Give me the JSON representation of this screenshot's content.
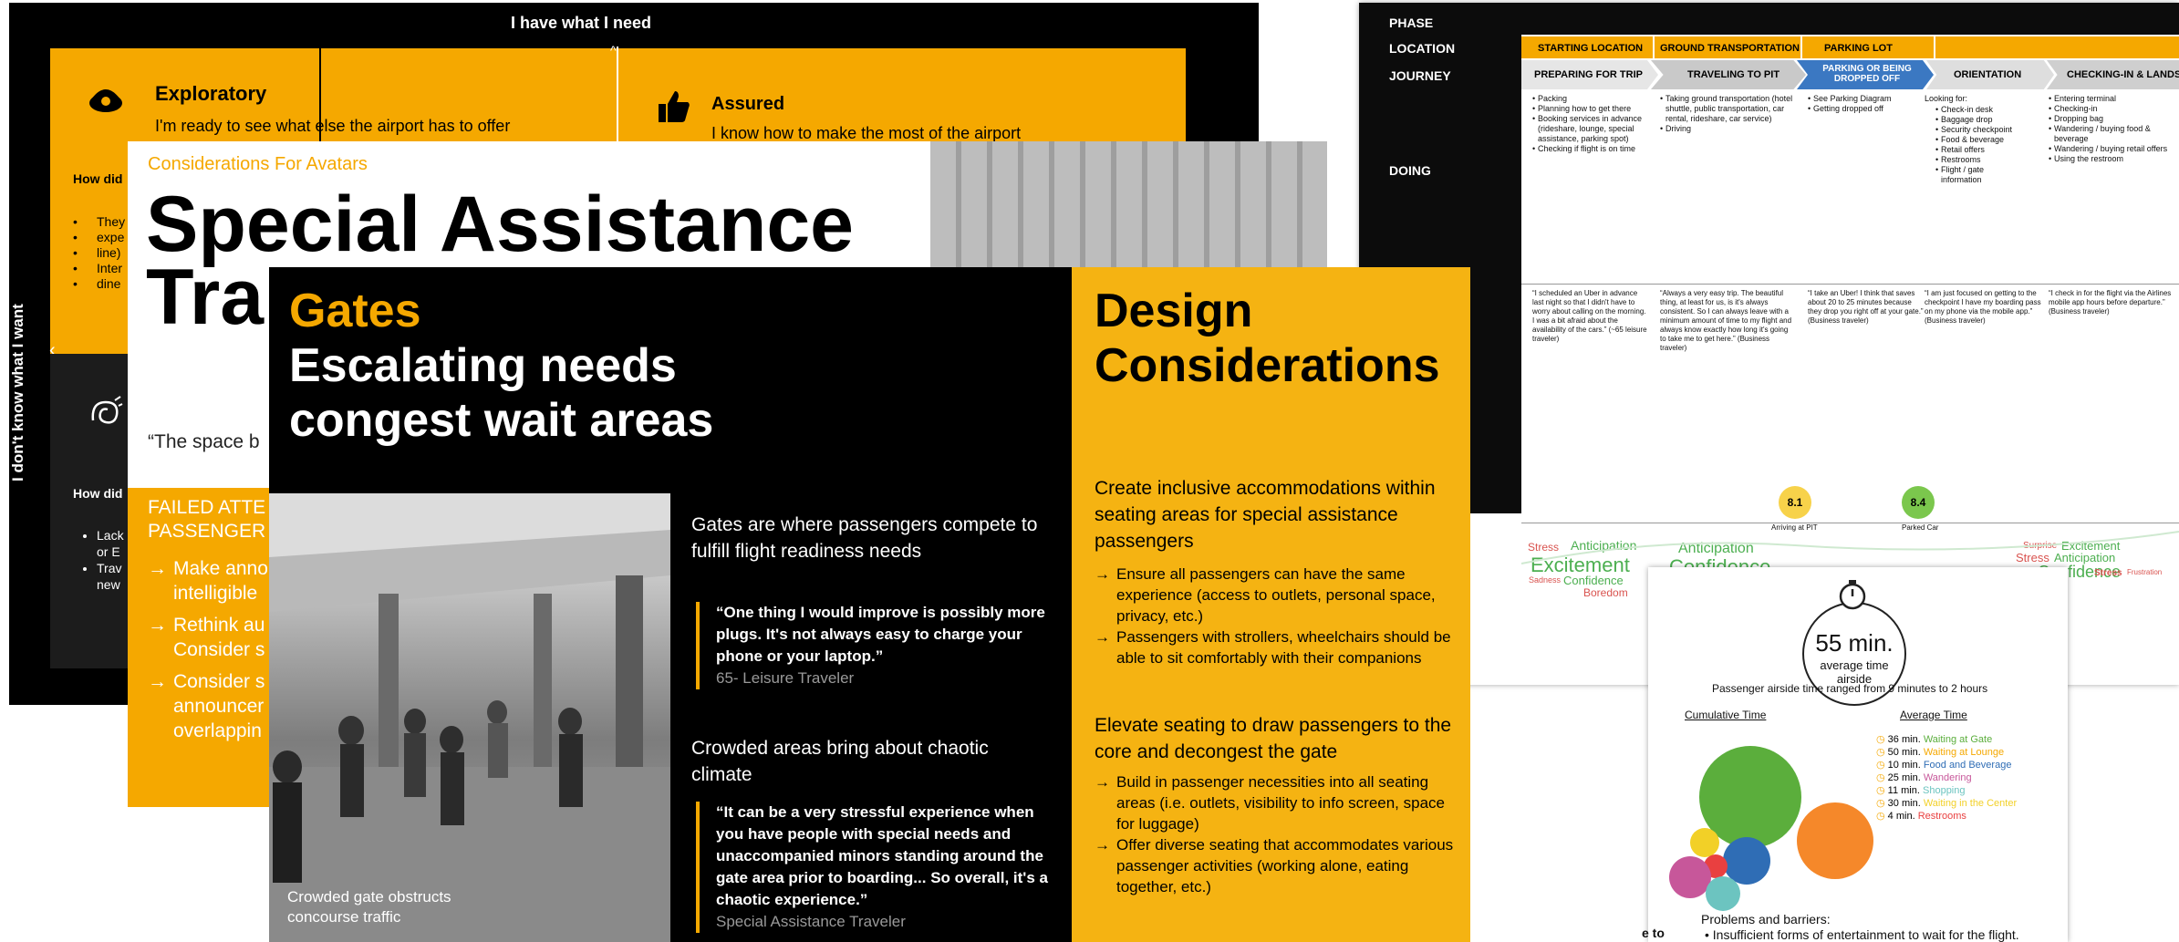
{
  "colors": {
    "accent": "#F5A800",
    "dark": "#000000",
    "dark_card": "#161616",
    "grey_text": "#999999"
  },
  "card1": {
    "top_label": "I have what I need",
    "left_axis": "I don't know what I want",
    "exploratory_title": "Exploratory",
    "exploratory_desc": "I'm ready to see what else the airport has to offer",
    "assured_title": "Assured",
    "assured_desc": "I know how to make the most of the airport",
    "how_did_1": "How did",
    "how_did_2": "How did",
    "bullets_top": [
      "They",
      "expe",
      "line)",
      "Inter",
      "dine"
    ],
    "bullets_bottom": [
      "Lack",
      "or E",
      "Trav",
      "new"
    ],
    "icon_exploratory": "oyster-pearl-icon",
    "icon_assured": "thumbs-up-icon",
    "icon_lower": "swirl-icon"
  },
  "card2": {
    "kicker": "Considerations For Avatars",
    "title_line1": "Special Assistance",
    "title_line2": "Tra",
    "quote_fragment": "“The space b",
    "failed_line1": "FAILED ATTE",
    "failed_line2": "PASSENGER",
    "items": [
      "Make anno",
      "intelligible",
      "Rethink au",
      "Consider s",
      "Consider s",
      "announcer",
      "overlappin"
    ]
  },
  "card3": {
    "title_yellow": "Gates",
    "title_white_1": "Escalating needs",
    "title_white_2": "congest wait areas",
    "photo_caption_1": "Crowded gate obstructs",
    "photo_caption_2": "concourse traffic",
    "section1_heading": "Gates are where passengers compete to fulfill flight readiness needs",
    "quote1": "“One thing I would improve is possibly more plugs. It's not always easy to charge your phone or your laptop.”",
    "quote1_author": "65- Leisure Traveler",
    "section2_heading": "Crowded areas bring about chaotic climate",
    "quote2": "“It can be a very stressful experience when you have people with special needs and unaccompanied minors standing around the gate area prior to boarding... So overall, it's a chaotic experience.”",
    "quote2_author": "Special Assistance Traveler"
  },
  "card4": {
    "title_1": "Design",
    "title_2": "Considerations",
    "heading1": "Create inclusive accommodations within seating areas for special assistance passengers",
    "items1": [
      "Ensure all passengers can have the same experience (access to outlets, personal space, privacy, etc.)",
      "Passengers with strollers, wheelchairs should be able to sit comfortably with their companions"
    ],
    "heading2": "Elevate seating to draw passengers to the core and decongest the gate",
    "items2": [
      "Build in passenger necessities into all seating areas (i.e. outlets, visibility to info screen, space for luggage)",
      "Offer diverse seating that accommodates various passenger activities (working alone, eating together, etc.)"
    ]
  },
  "card5": {
    "row_labels": [
      "PHASE",
      "LOCATION",
      "JOURNEY",
      "DOING"
    ],
    "locations": [
      "STARTING LOCATION",
      "GROUND TRANSPORTATION",
      "PARKING LOT"
    ],
    "journey": [
      "PREPARING FOR TRIP",
      "TRAVELING TO PIT",
      "PARKING OR BEING DROPPED OFF",
      "ORIENTATION",
      "CHECKING-IN & LANDSIDE"
    ],
    "doing": [
      [
        "Packing",
        "Planning how to get there",
        "Booking services in advance (rideshare, lounge, special assistance, parking spot)",
        "Checking if flight is on time"
      ],
      [
        "Taking ground transportation (hotel shuttle, public transportation, car rental, rideshare, car service)",
        "Driving"
      ],
      [
        "See Parking Diagram",
        "Getting dropped off"
      ],
      [
        "Check-in desk",
        "Baggage drop",
        "Security checkpoint",
        "Food & beverage",
        "Retail offers",
        "Restrooms",
        "Flight / gate information"
      ],
      [
        "Entering terminal",
        "Checking-in",
        "Dropping bag",
        "Wandering / buying food & beverage",
        "Wandering / buying retail offers",
        "Using the restroom"
      ]
    ],
    "looking_for": "Looking for:",
    "quotes": [
      "“I scheduled an Uber in advance last night so that I didn't have to worry about calling on the morning. I was a bit afraid about the availability of the cars.” (~65 leisure traveler)",
      "“Always a very easy trip. The beautiful thing, at least for us, is it's always consistent. So I can always leave with a minimum amount of time to my flight and always know exactly how long it's going to take me to get here.” (Business traveler)",
      "“I take an Uber! I think that saves about 20 to 25 minutes because they drop you right off at your gate.” (Business traveler)",
      "“I am just focused on getting to the checkpoint I have my boarding pass on my phone via the mobile app.” (Business traveler)",
      "“I check in for the flight via the Airlines mobile app hours before departure.” (Business traveler)"
    ],
    "scores": [
      {
        "value": "8.1",
        "label": "Arriving at PIT",
        "color": "#F7D24A"
      },
      {
        "value": "8.4",
        "label": "Parked Car",
        "color": "#7BC74D"
      }
    ],
    "emotion_words": [
      "Stress",
      "Anticipation",
      "Excitement",
      "Sadness",
      "Confidence",
      "Boredom",
      "Anticipation",
      "Confidence",
      "Surprise",
      "Excitement",
      "Stress",
      "Anticipation",
      "Confidence",
      "Stress",
      "Frustration"
    ]
  },
  "card6": {
    "timer_value": "55 min.",
    "timer_caption_1": "average time",
    "timer_caption_2": "airside",
    "range_text": "Passenger airside time ranged from 9 minutes to 2 hours",
    "col_left": "Cumulative Time",
    "col_right": "Average Time",
    "legend": [
      {
        "time": "36 min.",
        "label": "Waiting at Gate",
        "color": "#5BAE3C"
      },
      {
        "time": "50 min.",
        "label": "Waiting at Lounge",
        "color": "#F5A800"
      },
      {
        "time": "10 min.",
        "label": "Food and Beverage",
        "color": "#2F6DB5"
      },
      {
        "time": "25 min.",
        "label": "Wandering",
        "color": "#C7579A"
      },
      {
        "time": "11 min.",
        "label": "Shopping",
        "color": "#6CC4C0"
      },
      {
        "time": "30 min.",
        "label": "Waiting in the Center",
        "color": "#F2D027"
      },
      {
        "time": "4 min.",
        "label": "Restrooms",
        "color": "#E94040"
      }
    ],
    "problems_heading": "Problems and barriers:",
    "problem_1": "Insufficient forms of entertainment to wait for the flight.",
    "edge_fragment": "e to"
  }
}
